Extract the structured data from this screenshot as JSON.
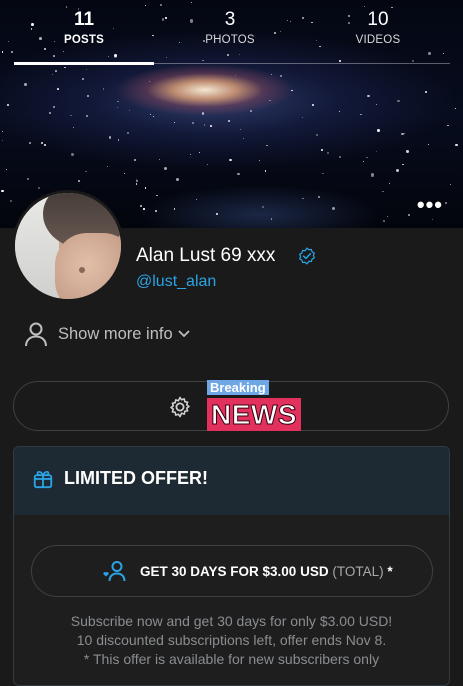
{
  "stats": [
    {
      "count": "11",
      "label": "POSTS"
    },
    {
      "count": "3",
      "label": "PHOTOS"
    },
    {
      "count": "10",
      "label": "VIDEOS"
    }
  ],
  "profile": {
    "name": "Alan Lust 69 xxx",
    "handle": "@lust_alan",
    "show_more": "Show more info"
  },
  "subscribe_sticker": {
    "top": "Breaking",
    "main": "NEWS"
  },
  "offer": {
    "title": "LIMITED OFFER!",
    "button_main": "GET 30 DAYS FOR $3.00 USD",
    "button_suffix": "(TOTAL)",
    "button_star": "*",
    "note_lines": [
      "Subscribe now and get 30 days for only $3.00 USD!",
      "10 discounted subscriptions left, offer ends Nov 8.",
      "* This offer is available for new subscribers only"
    ]
  },
  "colors": {
    "accent": "#2aa4e5",
    "background": "#1a1a1b",
    "sticker_blue": "#6ea6e6",
    "sticker_red": "#e3315d"
  },
  "icons": [
    "more-icon",
    "verified-icon",
    "user-icon",
    "chevron-down-icon",
    "gear-icon",
    "gift-icon",
    "subscribe-user-icon"
  ]
}
